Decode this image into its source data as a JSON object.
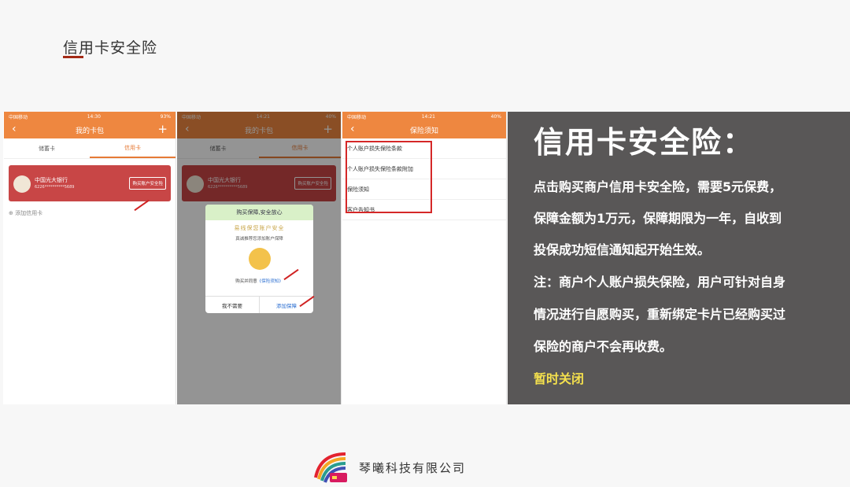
{
  "slide": {
    "title": "信用卡安全险",
    "company": "琴曦科技有限公司"
  },
  "phone1": {
    "status_left": "中国移动",
    "status_time": "14:30",
    "status_right": "93%",
    "nav_title": "我的卡包",
    "tabs": [
      "储蓄卡",
      "信用卡"
    ],
    "card": {
      "bank": "中国光大银行",
      "number": "6226**********5689",
      "button": "购买账户安全险"
    },
    "add_card": "添加信用卡"
  },
  "phone2": {
    "status_left": "中国移动",
    "status_time": "14:21",
    "status_right": "40%",
    "nav_title": "我的卡包",
    "tabs": [
      "储蓄卡",
      "信用卡"
    ],
    "card": {
      "bank": "中国光大银行",
      "number": "6226**********5689",
      "button": "购买账户安全险"
    },
    "dialog": {
      "header": "购买保障,安全放心",
      "slogan": "易线保您账户安全",
      "text": "真诚推荐您添加账户保障",
      "agree_prefix": "购买并同意",
      "agree_link": "《保险须知》",
      "no": "我不需要",
      "yes": "添加保障"
    }
  },
  "phone3": {
    "status_left": "中国移动",
    "status_time": "14:21",
    "status_right": "40%",
    "nav_title": "保险须知",
    "items": [
      "个人账户损失保险条款",
      "个人账户损失保险条款附加",
      "保险须知",
      "客户告知书"
    ]
  },
  "panel": {
    "title": "信用卡安全险：",
    "lines": [
      "点击购买商户信用卡安全险，需要5元保费，",
      "保障金额为1万元，保障期限为一年，自收到",
      "投保成功短信通知起开始生效。",
      "注：商户个人账户损失保险，用户可针对自身",
      "情况进行自愿购买，重新绑定卡片已经购买过",
      "保险的商户不会再收费。"
    ],
    "status": "暂时关闭"
  },
  "colors": {
    "accent": "#ee8740",
    "panel_bg": "#595757",
    "highlight": "#f4e04d",
    "title_bar": "#a32a16"
  }
}
